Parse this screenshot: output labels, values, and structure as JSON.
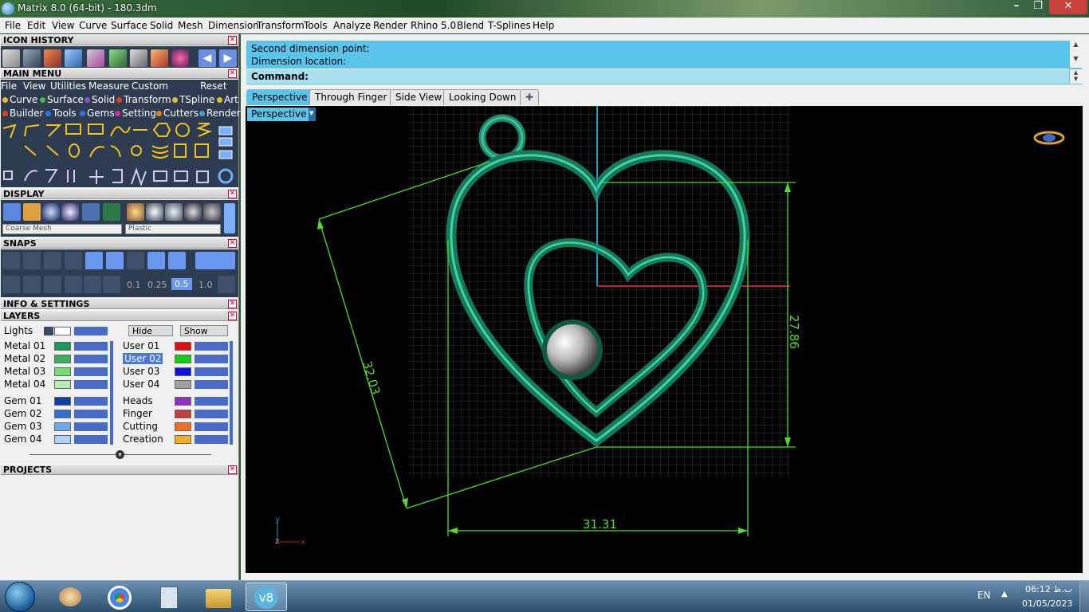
{
  "window": {
    "title": "Matrix 8.0 (64-bit) - 180.3dm"
  },
  "menu": [
    "File",
    "Edit",
    "View",
    "Curve",
    "Surface",
    "Solid",
    "Mesh",
    "Dimension",
    "Transform",
    "Tools",
    "Analyze",
    "Render",
    "Rhino 5.0",
    "Blend",
    "T-Splines",
    "Help"
  ],
  "panels": {
    "icon_history": "ICON HISTORY",
    "main_menu": "MAIN MENU",
    "display": "DISPLAY",
    "snaps": "SNAPS",
    "info": "INFO & SETTINGS",
    "layers": "LAYERS",
    "projects": "PROJECTS"
  },
  "main_menu": {
    "row1": [
      "File",
      "View",
      "Utilities",
      "Measure",
      "Custom"
    ],
    "reset": "Reset",
    "row2": [
      {
        "label": "Curve",
        "color": "#e0c020"
      },
      {
        "label": "Surface",
        "color": "#4ab848"
      },
      {
        "label": "Solid",
        "color": "#9050d0"
      },
      {
        "label": "Transform",
        "color": "#e04020"
      },
      {
        "label": "TSpline",
        "color": "#e0c020"
      },
      {
        "label": "Art",
        "color": "#e0c020"
      }
    ],
    "row3": [
      {
        "label": "Builder",
        "color": "#e04020"
      },
      {
        "label": "Tools",
        "color": "#2080e0"
      },
      {
        "label": "Gems",
        "color": "#3a70d8"
      },
      {
        "label": "Setting",
        "color": "#d03090"
      },
      {
        "label": "Cutters",
        "color": "#e08020"
      },
      {
        "label": "Render",
        "color": "#40a0c0"
      }
    ]
  },
  "display": {
    "mesh": "Coarse Mesh",
    "material": "Plastic"
  },
  "snaps": {
    "values": [
      "0.1",
      "0.25",
      "0.5",
      "1.0"
    ]
  },
  "layers": {
    "lights": "Lights",
    "hide": "Hide",
    "show": "Show",
    "left": [
      {
        "name": "Metal 01",
        "color": "#1a9a5a"
      },
      {
        "name": "Metal 02",
        "color": "#38b060"
      },
      {
        "name": "Metal 03",
        "color": "#70e070"
      },
      {
        "name": "Metal 04",
        "color": "#b0f0b0"
      },
      {
        "name": "Gem 01",
        "color": "#1040a0"
      },
      {
        "name": "Gem 02",
        "color": "#3070d0"
      },
      {
        "name": "Gem 03",
        "color": "#70a8f0"
      },
      {
        "name": "Gem 04",
        "color": "#b0d0f8"
      }
    ],
    "right": [
      {
        "name": "User 01",
        "color": "#e01010"
      },
      {
        "name": "User 02",
        "color": "#10d010"
      },
      {
        "name": "User 03",
        "color": "#1010e0"
      },
      {
        "name": "User 04",
        "color": "#a0a0a0"
      },
      {
        "name": "Heads",
        "color": "#9030c0"
      },
      {
        "name": "Finger",
        "color": "#c04040"
      },
      {
        "name": "Cutting",
        "color": "#f07020"
      },
      {
        "name": "Creation",
        "color": "#f0b020"
      }
    ]
  },
  "command": {
    "line1": "Second dimension point:",
    "line2": "Dimension location:",
    "prompt": "Command:"
  },
  "tabs": [
    "Perspective",
    "Through Finger",
    "Side View",
    "Looking Down"
  ],
  "viewport": {
    "label": "Perspective",
    "dims": {
      "left": "32.03",
      "right": "27.86",
      "bottom": "31.31"
    },
    "axis": {
      "y": "y",
      "z": "z",
      "x": "x"
    }
  },
  "taskbar": {
    "lang": "EN",
    "time": "06:12 ب.ظ",
    "date": "01/05/2023"
  }
}
